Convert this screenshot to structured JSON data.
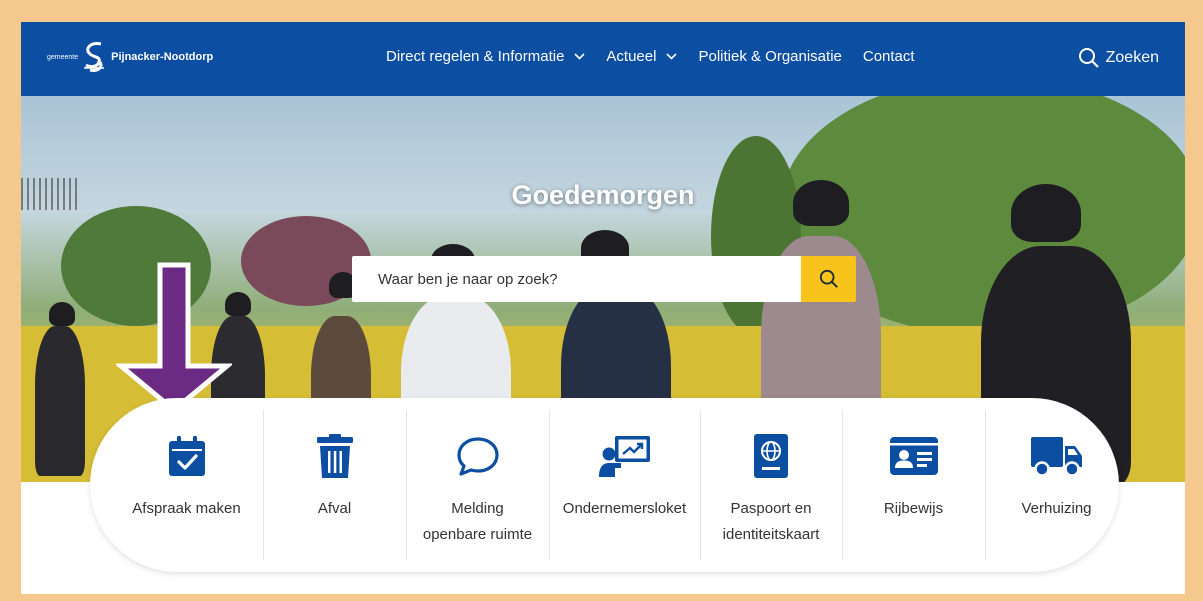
{
  "header": {
    "logo_small": "gemeente",
    "logo_name": "Pijnacker-Nootdorp",
    "nav": [
      {
        "label": "Direct regelen & Informatie",
        "dropdown": true
      },
      {
        "label": "Actueel",
        "dropdown": true
      },
      {
        "label": "Politiek & Organisatie",
        "dropdown": false
      },
      {
        "label": "Contact",
        "dropdown": false
      }
    ],
    "search_label": "Zoeken"
  },
  "hero": {
    "greeting": "Goedemorgen",
    "search_placeholder": "Waar ben je naar op zoek?"
  },
  "tiles": [
    {
      "label": "Afspraak maken",
      "icon": "calendar-check-icon"
    },
    {
      "label": "Afval",
      "icon": "trash-bin-icon"
    },
    {
      "label": "Melding openbare ruimte",
      "icon": "speech-bubble-icon"
    },
    {
      "label": "Ondernemersloket",
      "icon": "presentation-board-icon"
    },
    {
      "label": "Paspoort en identiteitskaart",
      "icon": "passport-icon"
    },
    {
      "label": "Rijbewijs",
      "icon": "id-card-icon"
    },
    {
      "label": "Verhuizing",
      "icon": "moving-truck-icon"
    }
  ],
  "colors": {
    "brand_blue": "#0b4ea2",
    "icon_blue": "#0b4ea2",
    "search_button": "#f8c41b",
    "frame_border": "#f5c98d",
    "annotation_arrow": "#6b2a83"
  }
}
